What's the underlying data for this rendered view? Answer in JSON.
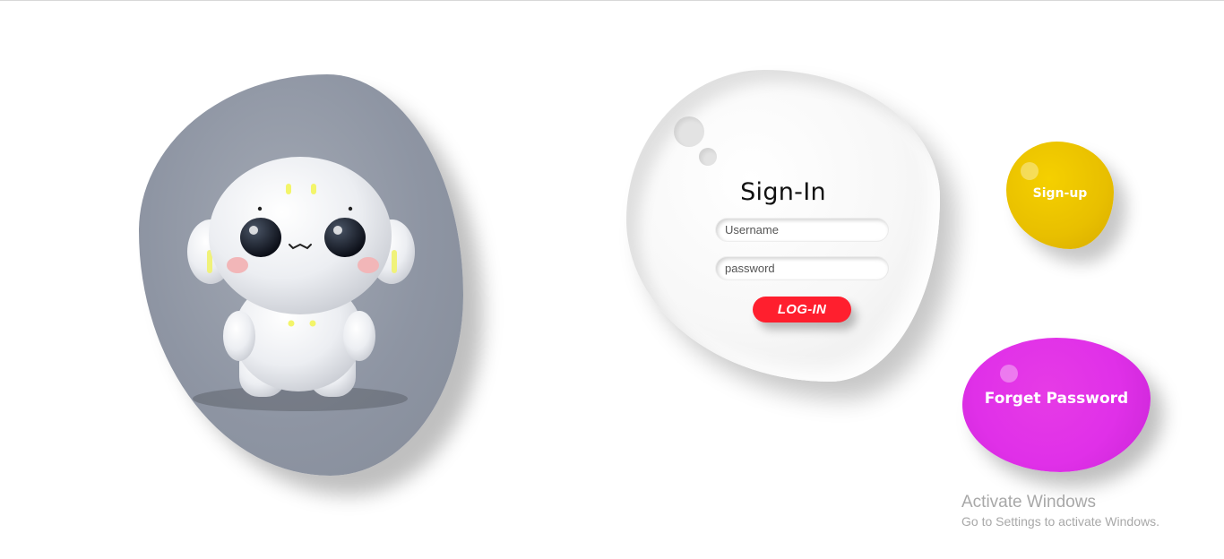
{
  "signin": {
    "title": "Sign-In",
    "username_placeholder": "Username",
    "password_placeholder": "password",
    "login_label": "LOG-IN"
  },
  "signup": {
    "label": "Sign-up"
  },
  "forget": {
    "label": "Forget Password"
  },
  "watermark": {
    "title": "Activate Windows",
    "subtitle": "Go to Settings to activate Windows."
  },
  "colors": {
    "login_button": "#ff1f2e",
    "signup_blob": "#f0c800",
    "forget_blob": "#e033e8",
    "image_background": "#8e95a3"
  },
  "image": {
    "subject": "white-robot-mascot"
  }
}
